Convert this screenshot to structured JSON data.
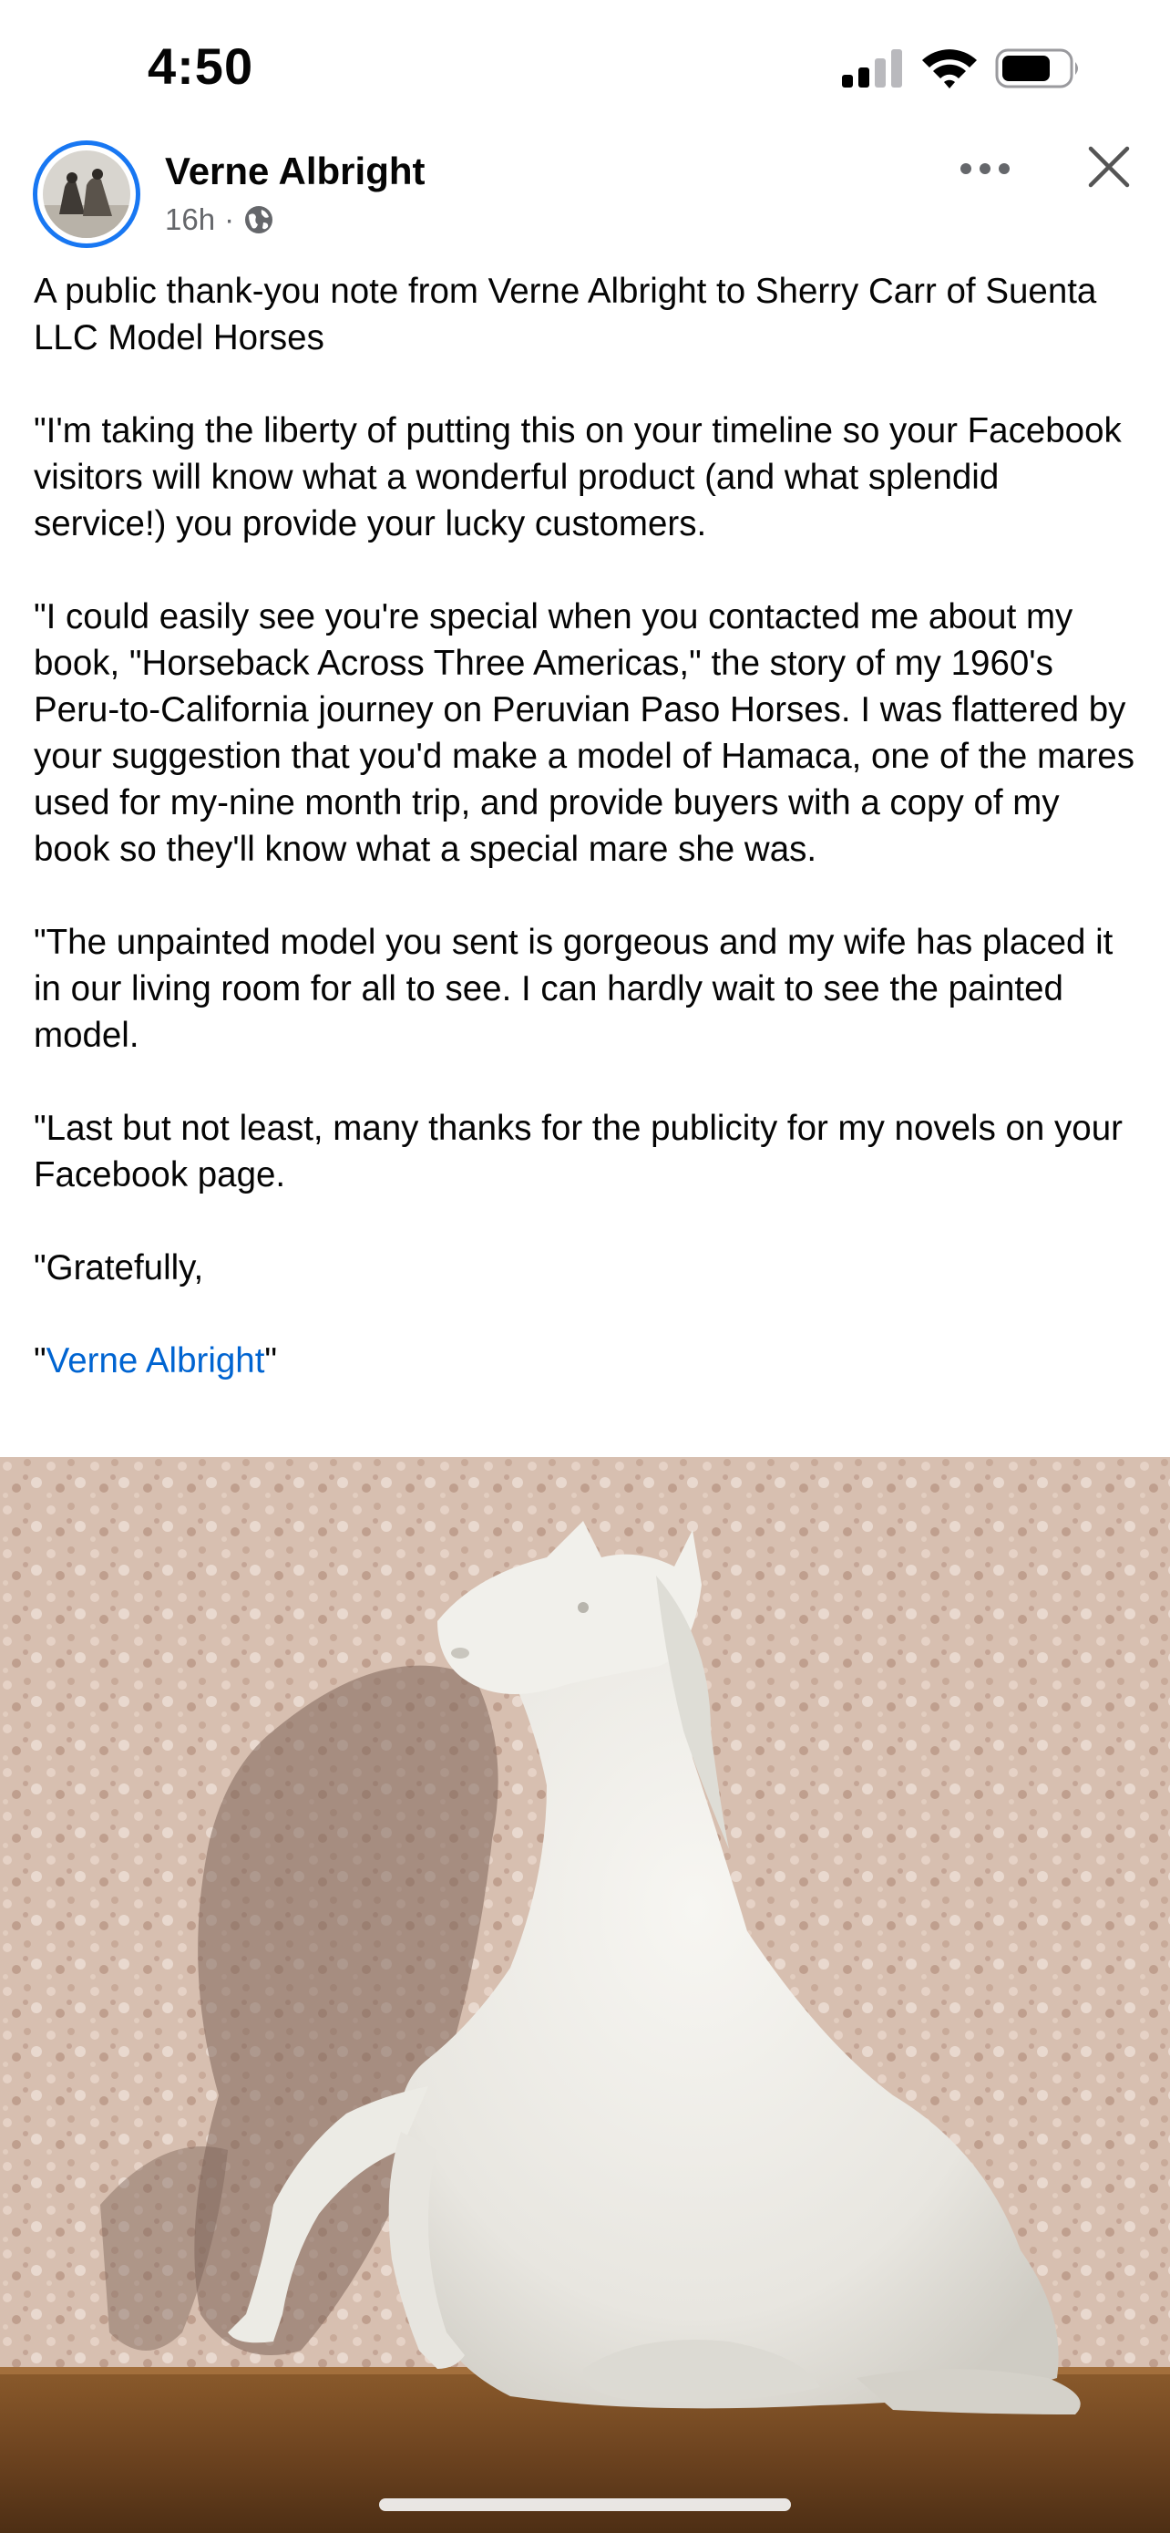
{
  "status_bar": {
    "time": "4:50",
    "icons": [
      "cellular-signal-icon",
      "wifi-icon",
      "battery-icon"
    ]
  },
  "post": {
    "author": "Verne Albright",
    "timestamp": "16h",
    "separator": "·",
    "audience_icon": "globe-icon",
    "menu_icon": "more-options-icon",
    "close_icon": "close-icon",
    "paragraphs": [
      "A public thank-you note from Verne Albright to Sherry Carr of Suenta LLC Model Horses",
      "\"I'm taking the liberty of putting this on your timeline so your Facebook visitors will know what a wonderful product (and what splendid service!) you provide your lucky customers.",
      "\"I could easily see you're special when you contacted me about my book, \"Horseback Across Three Americas,\" the story of my 1960's Peru-to-California journey on Peruvian Paso Horses. I was flattered by your suggestion that you'd make a model of Hamaca, one of the mares used for my-nine month trip, and provide buyers with a copy of my book so they'll know what a special mare she was.",
      "\"The unpainted model you sent is gorgeous and my wife has placed it in our living room for all to see. I can hardly wait to see the painted model.",
      "\"Last but not least, many thanks for the publicity for my novels on your Facebook page.",
      "\"Gratefully,"
    ],
    "signature": {
      "open_quote": "\"",
      "link_text": "Verne Albright",
      "close_quote": "\""
    }
  },
  "colors": {
    "accent_blue": "#1877f2",
    "link_blue": "#0064d1",
    "secondary_text": "#65676b"
  }
}
